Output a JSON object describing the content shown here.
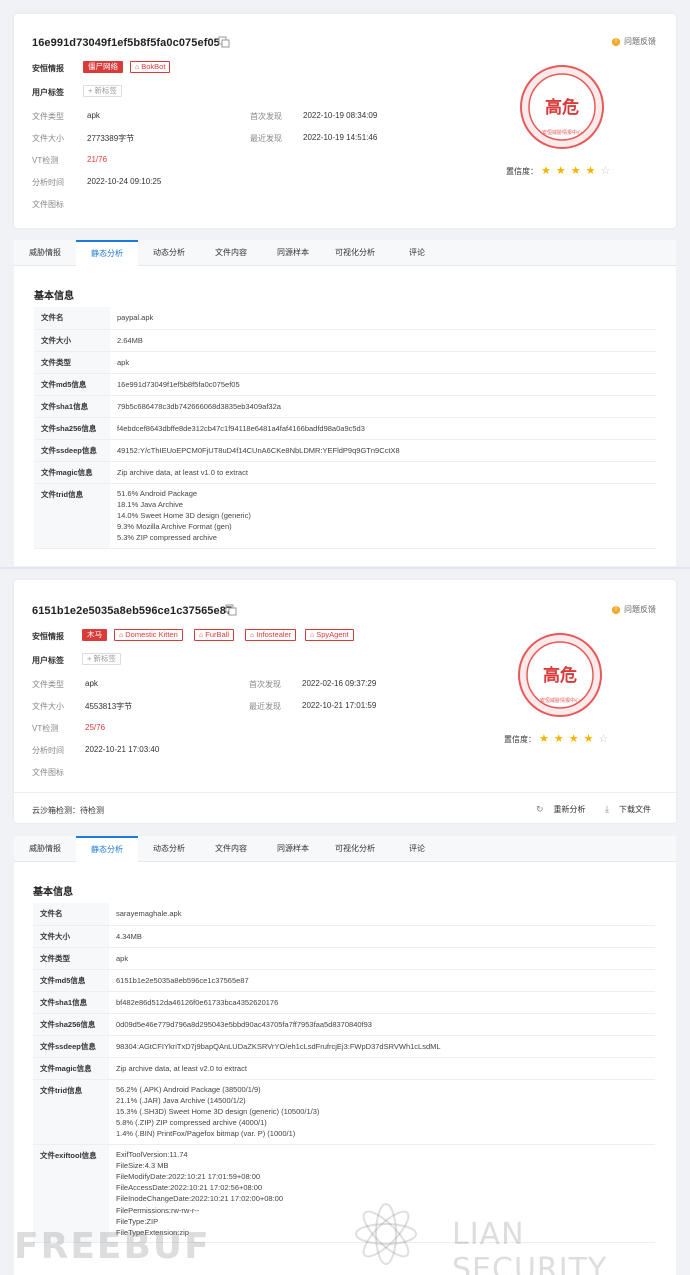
{
  "report1": {
    "hash": "16e991d73049f1ef5b8f5fa0c075ef05",
    "feedback": "问题反馈",
    "intel_label": "安恒情报",
    "tags": [
      {
        "text": "僵尸网络",
        "style": "solid"
      },
      {
        "text": "BokBot",
        "style": "outline"
      }
    ],
    "user_tag_label": "用户标签",
    "new_tag": "+ 新标签",
    "meta": {
      "file_type_label": "文件类型",
      "file_type": "apk",
      "file_size_label": "文件大小",
      "file_size": "2773389字节",
      "vt_label": "VT检测",
      "vt": "21/76",
      "analysis_time_label": "分析时间",
      "analysis_time": "2022-10-24 09:10:25",
      "icon_label": "文件图标",
      "first_seen_label": "首次发现",
      "first_seen": "2022-10-19 08:34:09",
      "last_seen_label": "最近发现",
      "last_seen": "2022-10-19 14:51:46"
    },
    "risk": "高危",
    "risk_caption": "安恒威胁情报中心",
    "confidence_label": "置信度：",
    "confidence": 4,
    "confidence_max": 5
  },
  "tabs1": [
    "威胁情报",
    "静态分析",
    "动态分析",
    "文件内容",
    "同源样本",
    "可视化分析",
    "评论"
  ],
  "basic1": {
    "title": "基本信息",
    "rows": [
      {
        "k": "文件名",
        "v": "paypal.apk"
      },
      {
        "k": "文件大小",
        "v": "2.64MB"
      },
      {
        "k": "文件类型",
        "v": "apk"
      },
      {
        "k": "文件md5信息",
        "v": "16e991d73049f1ef5b8f5fa0c075ef05"
      },
      {
        "k": "文件sha1信息",
        "v": "79b5c686478c3db742666068d3835eb3409af32a"
      },
      {
        "k": "文件sha256信息",
        "v": "f4ebdcef8643dbffe8de312cb47c1f94118e6481a4faf4166badfd98a0a9c5d3"
      },
      {
        "k": "文件ssdeep信息",
        "v": "49152:Y/cThIEUoEPCM0FjUT8uD4f14CUnA6CKe8NbLDMR:YEFldP9q9GTn9CctX8"
      },
      {
        "k": "文件magic信息",
        "v": "Zip archive data, at least v1.0 to extract"
      }
    ],
    "trid_label": "文件trid信息",
    "trid": [
      "51.6% Android Package",
      "18.1% Java Archive",
      "14.0% Sweet Home 3D design (generic)",
      "9.3% Mozilla Archive Format (gen)",
      "5.3% ZIP compressed archive"
    ]
  },
  "report2": {
    "hash": "6151b1e2e5035a8eb596ce1c37565e87",
    "feedback": "问题反馈",
    "intel_label": "安恒情报",
    "tags": [
      {
        "text": "木马",
        "style": "solid"
      },
      {
        "text": "Domestic Kitten",
        "style": "outline"
      },
      {
        "text": "FurBall",
        "style": "outline"
      },
      {
        "text": "Infostealer",
        "style": "outline"
      },
      {
        "text": "SpyAgent",
        "style": "outline"
      }
    ],
    "user_tag_label": "用户标签",
    "new_tag": "+ 新标签",
    "meta": {
      "file_type_label": "文件类型",
      "file_type": "apk",
      "file_size_label": "文件大小",
      "file_size": "4553813字节",
      "vt_label": "VT检测",
      "vt": "25/76",
      "analysis_time_label": "分析时间",
      "analysis_time": "2022-10-21 17:03:40",
      "icon_label": "文件图标",
      "first_seen_label": "首次发现",
      "first_seen": "2022-02-16 09:37:29",
      "last_seen_label": "最近发现",
      "last_seen": "2022-10-21 17:01:59"
    },
    "risk": "高危",
    "risk_caption": "安恒威胁情报中心",
    "confidence_label": "置信度：",
    "confidence": 4,
    "confidence_max": 5,
    "sandbox": "云沙箱检测：待检测",
    "reanalyze": "重新分析",
    "download": "下载文件"
  },
  "tabs2": [
    "威胁情报",
    "静态分析",
    "动态分析",
    "文件内容",
    "同源样本",
    "可视化分析",
    "评论"
  ],
  "basic2": {
    "title": "基本信息",
    "rows": [
      {
        "k": "文件名",
        "v": "sarayemaghale.apk"
      },
      {
        "k": "文件大小",
        "v": "4.34MB"
      },
      {
        "k": "文件类型",
        "v": "apk"
      },
      {
        "k": "文件md5信息",
        "v": "6151b1e2e5035a8eb596ce1c37565e87"
      },
      {
        "k": "文件sha1信息",
        "v": "bf482e86d512da46126f0e61733bca4352620176"
      },
      {
        "k": "文件sha256信息",
        "v": "0d09d5e46e779d796a8d295043e5bbd90ac43705fa7ff7953faa5d8370840f93"
      },
      {
        "k": "文件ssdeep信息",
        "v": "98304:AGtCFIYkriTxD7j9bapQAnLUDaZKSRVrYO/eh1cLsdFrufrcjEj3:FWpD37dSRVWh1cLsdML"
      },
      {
        "k": "文件magic信息",
        "v": "Zip archive data, at least v2.0 to extract"
      }
    ],
    "trid_label": "文件trid信息",
    "trid": [
      "56.2% (.APK) Android Package (38500/1/9)",
      "21.1% (.JAR) Java Archive (14500/1/2)",
      "15.3% (.SH3D) Sweet Home 3D design (generic) (10500/1/3)",
      "5.8% (.ZIP) ZIP compressed archive (4000/1)",
      "1.4% (.BIN) PrintFox/Pagefox bitmap (var. P) (1000/1)"
    ],
    "exif_label": "文件exiftool信息",
    "exif": [
      "ExifToolVersion:11.74",
      "FileSize:4.3 MB",
      "FileModifyDate:2022:10:21 17:01:59+08:00",
      "FileAccessDate:2022:10:21 17:02:56+08:00",
      "FileInodeChangeDate:2022:10:21 17:02:00+08:00",
      "FilePermissions:rw-rw-r--",
      "FileType:ZIP",
      "FileTypeExtension:zip"
    ]
  },
  "watermarks": {
    "left": "FREEBUF",
    "right": "LIAN SECURITY"
  },
  "colors": {
    "accent": "#1e7bd8",
    "danger": "#d93b3b",
    "star": "#f5b400"
  }
}
